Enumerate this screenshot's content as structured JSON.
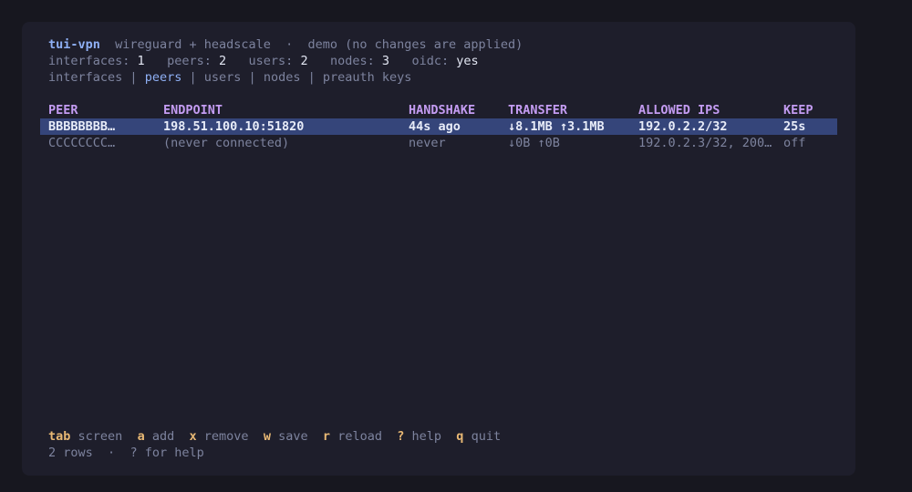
{
  "header": {
    "app_name": "tui-vpn",
    "subtitle": "wireguard + headscale",
    "dot": "·",
    "mode": "demo (no changes are applied)"
  },
  "stats": [
    {
      "label": "interfaces:",
      "value": "1"
    },
    {
      "label": "peers:",
      "value": "2"
    },
    {
      "label": "users:",
      "value": "2"
    },
    {
      "label": "nodes:",
      "value": "3"
    },
    {
      "label": "oidc:",
      "value": "yes"
    }
  ],
  "tabs": [
    {
      "label": "interfaces",
      "active": false
    },
    {
      "label": "peers",
      "active": true
    },
    {
      "label": "users",
      "active": false
    },
    {
      "label": "nodes",
      "active": false
    },
    {
      "label": "preauth keys",
      "active": false
    }
  ],
  "tab_separator": "|",
  "table": {
    "columns": [
      "PEER",
      "ENDPOINT",
      "HANDSHAKE",
      "TRANSFER",
      "ALLOWED IPS",
      "KEEP"
    ],
    "rows": [
      {
        "peer": "BBBBBBBB…",
        "endpoint": "198.51.100.10:51820",
        "handshake": "44s ago",
        "transfer": "↓8.1MB ↑3.1MB",
        "allowed_ips": "192.0.2.2/32",
        "keep": "25s",
        "selected": true
      },
      {
        "peer": "CCCCCCCC…",
        "endpoint": "(never connected)",
        "handshake": "never",
        "transfer": "↓0B ↑0B",
        "allowed_ips": "192.0.2.3/32, 200…",
        "keep": "off",
        "selected": false
      }
    ]
  },
  "keybinds": [
    {
      "key": "tab",
      "action": "screen"
    },
    {
      "key": "a",
      "action": "add"
    },
    {
      "key": "x",
      "action": "remove"
    },
    {
      "key": "w",
      "action": "save"
    },
    {
      "key": "r",
      "action": "reload"
    },
    {
      "key": "?",
      "action": "help"
    },
    {
      "key": "q",
      "action": "quit"
    }
  ],
  "status": {
    "rows": "2 rows",
    "dot": "·",
    "hint": "? for help"
  },
  "colors": {
    "background": "#1e1e2b",
    "accent": "#8fb0f5",
    "header": "#c49cf2",
    "key": "#e8b874",
    "selection": "#35457a"
  }
}
